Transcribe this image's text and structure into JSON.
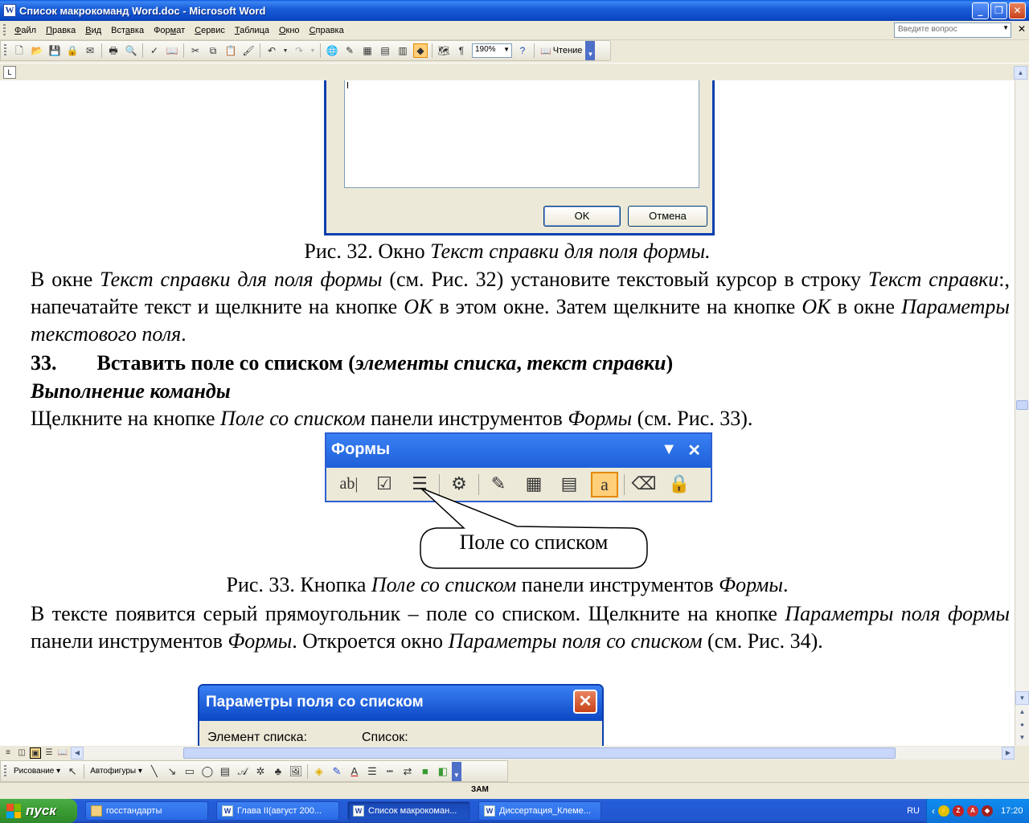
{
  "window": {
    "title": "Список макрокоманд Word.doc - Microsoft Word",
    "app_icon": "W"
  },
  "menu": {
    "items": [
      {
        "pre": "",
        "key": "Ф",
        "post": "айл"
      },
      {
        "pre": "",
        "key": "П",
        "post": "равка"
      },
      {
        "pre": "",
        "key": "В",
        "post": "ид"
      },
      {
        "pre": "Вст",
        "key": "а",
        "post": "вка"
      },
      {
        "pre": "Фор",
        "key": "м",
        "post": "ат"
      },
      {
        "pre": "",
        "key": "С",
        "post": "ервис"
      },
      {
        "pre": "",
        "key": "Т",
        "post": "аблица"
      },
      {
        "pre": "",
        "key": "О",
        "post": "кно"
      },
      {
        "pre": "",
        "key": "С",
        "post": "правка"
      }
    ],
    "ask_placeholder": "Введите вопрос"
  },
  "toolbar": {
    "zoom": "190%",
    "reading_label": "Чтение",
    "icons": [
      "new-icon",
      "open-icon",
      "save-icon",
      "permission-icon",
      "email-icon",
      "print-icon",
      "print-preview-icon",
      "spelling-icon",
      "research-icon",
      "cut-icon",
      "copy-icon",
      "paste-icon",
      "format-painter-icon",
      "undo-icon",
      "redo-icon",
      "hyperlink-icon",
      "tables-borders-icon",
      "insert-table-icon",
      "insert-excel-icon",
      "columns-icon",
      "drawing-icon",
      "document-map-icon",
      "show-formatting-icon",
      "help-icon"
    ]
  },
  "document": {
    "dialog32": {
      "ok": "OK",
      "cancel": "Отмена"
    },
    "caption32": {
      "a": "Рис. 32. Окно ",
      "b": "Текст справки для поля формы."
    },
    "p1": {
      "a": "В окне ",
      "b": "Текст справки для поля формы",
      "c": " (см. Рис. 32) установите текстовый курсор в строку ",
      "d": "Текст справки",
      "e": ":, напечатайте текст и щелкните на кнопке ",
      "f": "OK",
      "g": " в этом окне. Затем щелкните на кнопке ",
      "h": "OK",
      "i": " в окне ",
      "j": "Параметры текстового поля",
      "k": "."
    },
    "heading33": {
      "num": "33.",
      "a": "Вставить поле со списком (",
      "b": "элементы списка",
      "c": ", ",
      "d": "текст справки",
      "e": ")"
    },
    "exec_heading": "Выполнение команды",
    "p2": {
      "a": "Щелкните на кнопке ",
      "b": "Поле со списком",
      "c": " панели инструментов ",
      "d": "Формы",
      "e": " (см. Рис. 33)."
    },
    "forms_toolbar": {
      "title": "Формы",
      "icons": [
        "text-field-icon",
        "checkbox-icon",
        "combo-box-icon",
        "form-field-options-icon",
        "draw-table-icon",
        "insert-table-icon",
        "insert-frame-icon",
        "field-shading-icon",
        "reset-fields-icon",
        "protect-form-icon"
      ]
    },
    "callout": "Поле со списком",
    "caption33": {
      "a": "Рис. 33. Кнопка ",
      "b": "Поле со списком",
      "c": " панели инструментов ",
      "d": "Формы",
      "e": "."
    },
    "p3": {
      "a": "В тексте появится серый прямоугольник – поле со списком. Щелкните на кнопке ",
      "b": "Параметры поля формы",
      "c": " панели инструментов ",
      "d": "Формы",
      "e": ". Откроется окно ",
      "f": "Параметры поля со списком",
      "g": " (см. Рис. 34)."
    },
    "dialog34": {
      "title": "Параметры поля со списком",
      "label_item": "Элемент списка:",
      "label_list": "Список:"
    }
  },
  "drawing_toolbar": {
    "draw_label": "Рисование",
    "autoshapes_label": "Автофигуры"
  },
  "statusbar": {
    "ovr": "ЗАМ"
  },
  "taskbar": {
    "start": "пуск",
    "tasks": [
      {
        "label": "госстандарты",
        "icon": "folder-icon"
      },
      {
        "label": "Глава II(август 200...",
        "icon": "word-icon"
      },
      {
        "label": "Список макрокоман...",
        "icon": "word-icon",
        "active": true
      },
      {
        "label": "Диссертация_Клеме...",
        "icon": "word-icon"
      }
    ],
    "lang": "RU",
    "clock": "17:20"
  },
  "colors": {
    "xp_blue": "#0a58e0",
    "accent_orange": "#ffcf7a"
  }
}
